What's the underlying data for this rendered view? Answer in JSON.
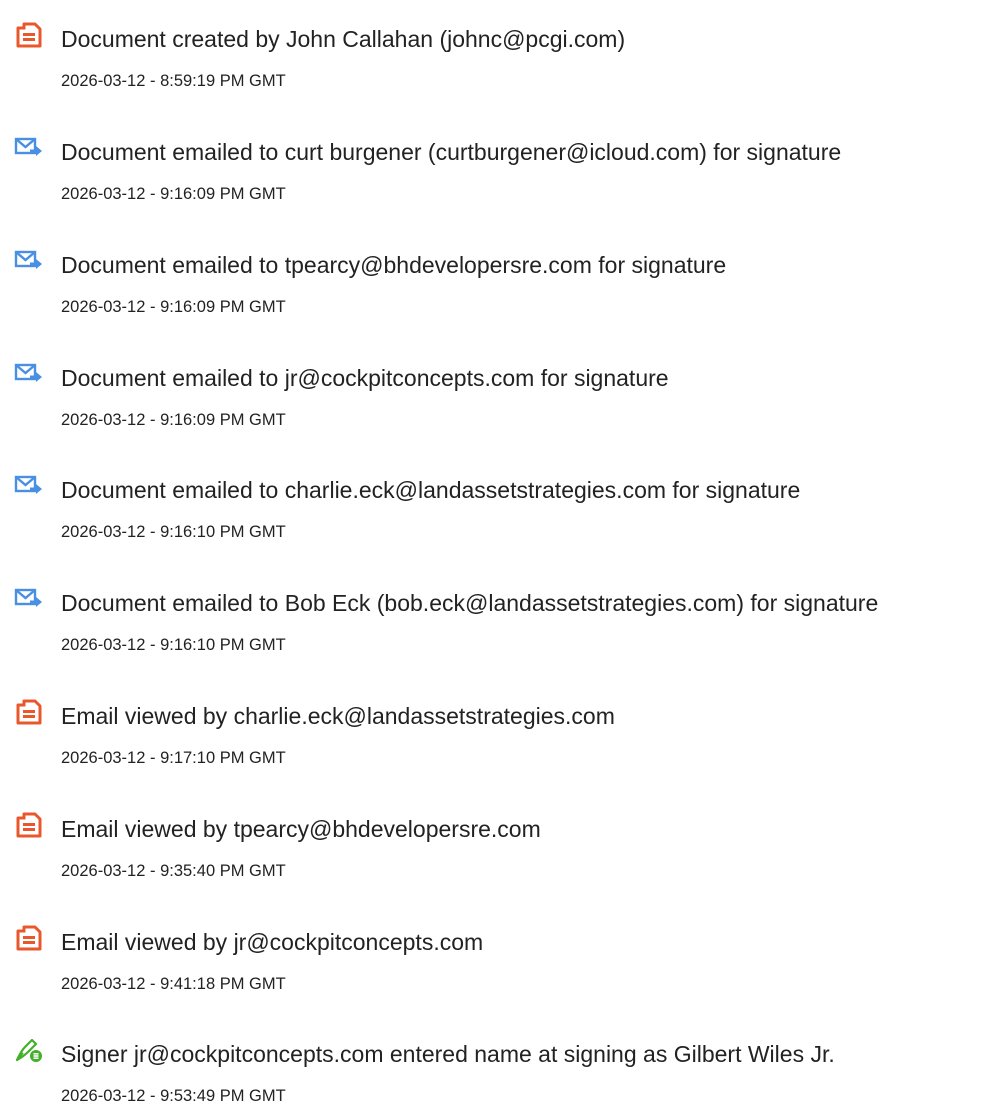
{
  "events": [
    {
      "icon": "document-icon",
      "text": "Document created by John Callahan (johnc@pcgi.com)",
      "time": "2026-03-12 - 8:59:19 PM GMT"
    },
    {
      "icon": "email-sent-icon",
      "text": "Document emailed to curt burgener (curtburgener@icloud.com) for signature",
      "time": "2026-03-12 - 9:16:09 PM GMT"
    },
    {
      "icon": "email-sent-icon",
      "text": "Document emailed to tpearcy@bhdevelopersre.com for signature",
      "time": "2026-03-12 - 9:16:09 PM GMT"
    },
    {
      "icon": "email-sent-icon",
      "text": "Document emailed to jr@cockpitconcepts.com for signature",
      "time": "2026-03-12 - 9:16:09 PM GMT"
    },
    {
      "icon": "email-sent-icon",
      "text": "Document emailed to charlie.eck@landassetstrategies.com for signature",
      "time": "2026-03-12 - 9:16:10 PM GMT"
    },
    {
      "icon": "email-sent-icon",
      "text": "Document emailed to Bob Eck (bob.eck@landassetstrategies.com) for signature",
      "time": "2026-03-12 - 9:16:10 PM GMT"
    },
    {
      "icon": "document-icon",
      "text": "Email viewed by charlie.eck@landassetstrategies.com",
      "time": "2026-03-12 - 9:17:10 PM GMT"
    },
    {
      "icon": "document-icon",
      "text": "Email viewed by tpearcy@bhdevelopersre.com",
      "time": "2026-03-12 - 9:35:40 PM GMT"
    },
    {
      "icon": "document-icon",
      "text": "Email viewed by jr@cockpitconcepts.com",
      "time": "2026-03-12 - 9:41:18 PM GMT"
    },
    {
      "icon": "signer-pen-icon",
      "text": "Signer jr@cockpitconcepts.com entered name at signing as Gilbert Wiles Jr.",
      "time": "2026-03-12 - 9:53:49 PM GMT"
    }
  ],
  "colors": {
    "document_icon": "#e8582c",
    "email_icon": "#4a90e2",
    "signer_icon": "#43b02a"
  }
}
